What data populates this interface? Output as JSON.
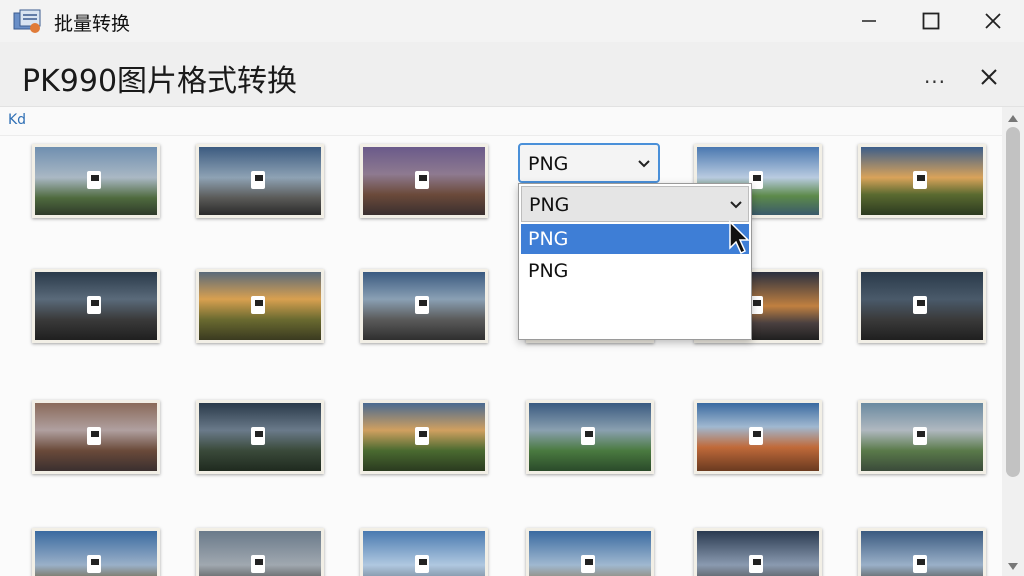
{
  "window": {
    "title": "批量转换",
    "icons": [
      "app-icon",
      "minimize-icon",
      "maximize-icon",
      "close-icon"
    ]
  },
  "header": {
    "page_title": "PK990图片格式转换",
    "more_label": "...",
    "close_icon": "close-icon"
  },
  "breadcrumb": {
    "label": "Kd"
  },
  "format_combo": {
    "value": "PNG",
    "dropdown": {
      "header_value": "PNG",
      "options": [
        "PNG",
        "PNG"
      ],
      "selected_index": 0
    }
  },
  "colors": {
    "accent": "#3e7ed6",
    "focus_border": "#4a90d9"
  }
}
